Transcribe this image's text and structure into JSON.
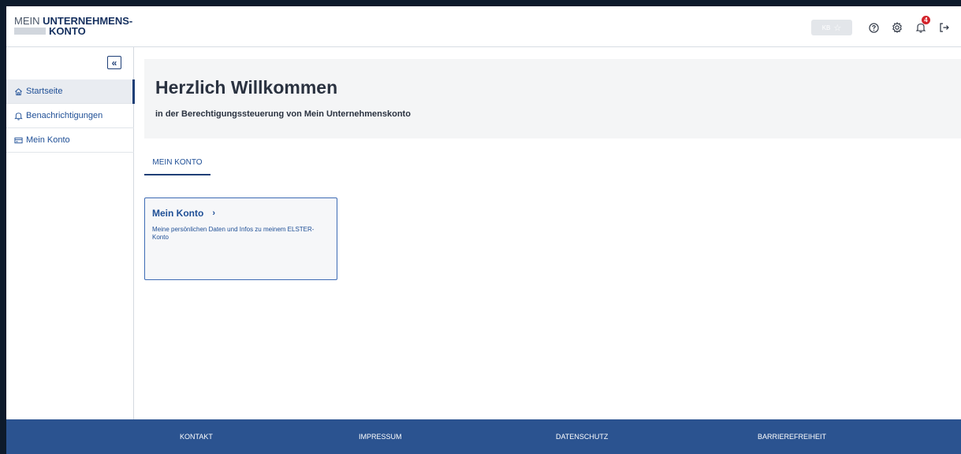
{
  "header": {
    "logo_line1_thin": "MEIN",
    "logo_line1_bold": "UNTERNEHMENS-",
    "logo_line2_bold": "KONTO",
    "kb_label": "KB",
    "icons": [
      "star-icon",
      "help-icon",
      "gear-icon",
      "bell-icon",
      "logout-icon"
    ],
    "notification_count": "4"
  },
  "sidebar": {
    "collapse_label": "«",
    "items": [
      {
        "label": "Startseite",
        "icon": "home-icon",
        "active": true
      },
      {
        "label": "Benachrichtigungen",
        "icon": "bell-icon",
        "active": false
      },
      {
        "label": "Mein Konto",
        "icon": "card-icon",
        "active": false
      }
    ]
  },
  "main": {
    "title": "Herzlich Willkommen",
    "subtitle": "in der Berechtigungssteuerung von Mein Unternehmenskonto",
    "tabs": [
      {
        "label": "MEIN KONTO",
        "active": true
      }
    ],
    "card": {
      "title": "Mein Konto",
      "chevron": "›",
      "description": "Meine persönlichen Daten und Infos zu meinem ELSTER-Konto"
    }
  },
  "footer": {
    "links": [
      "KONTAKT",
      "IMPRESSUM",
      "DATENSCHUTZ",
      "BARRIEREFREIHEIT"
    ]
  },
  "colors": {
    "accent": "#1f3f77",
    "link": "#1f4f96",
    "footer_bg": "#2b5390",
    "badge": "#d3242c"
  }
}
